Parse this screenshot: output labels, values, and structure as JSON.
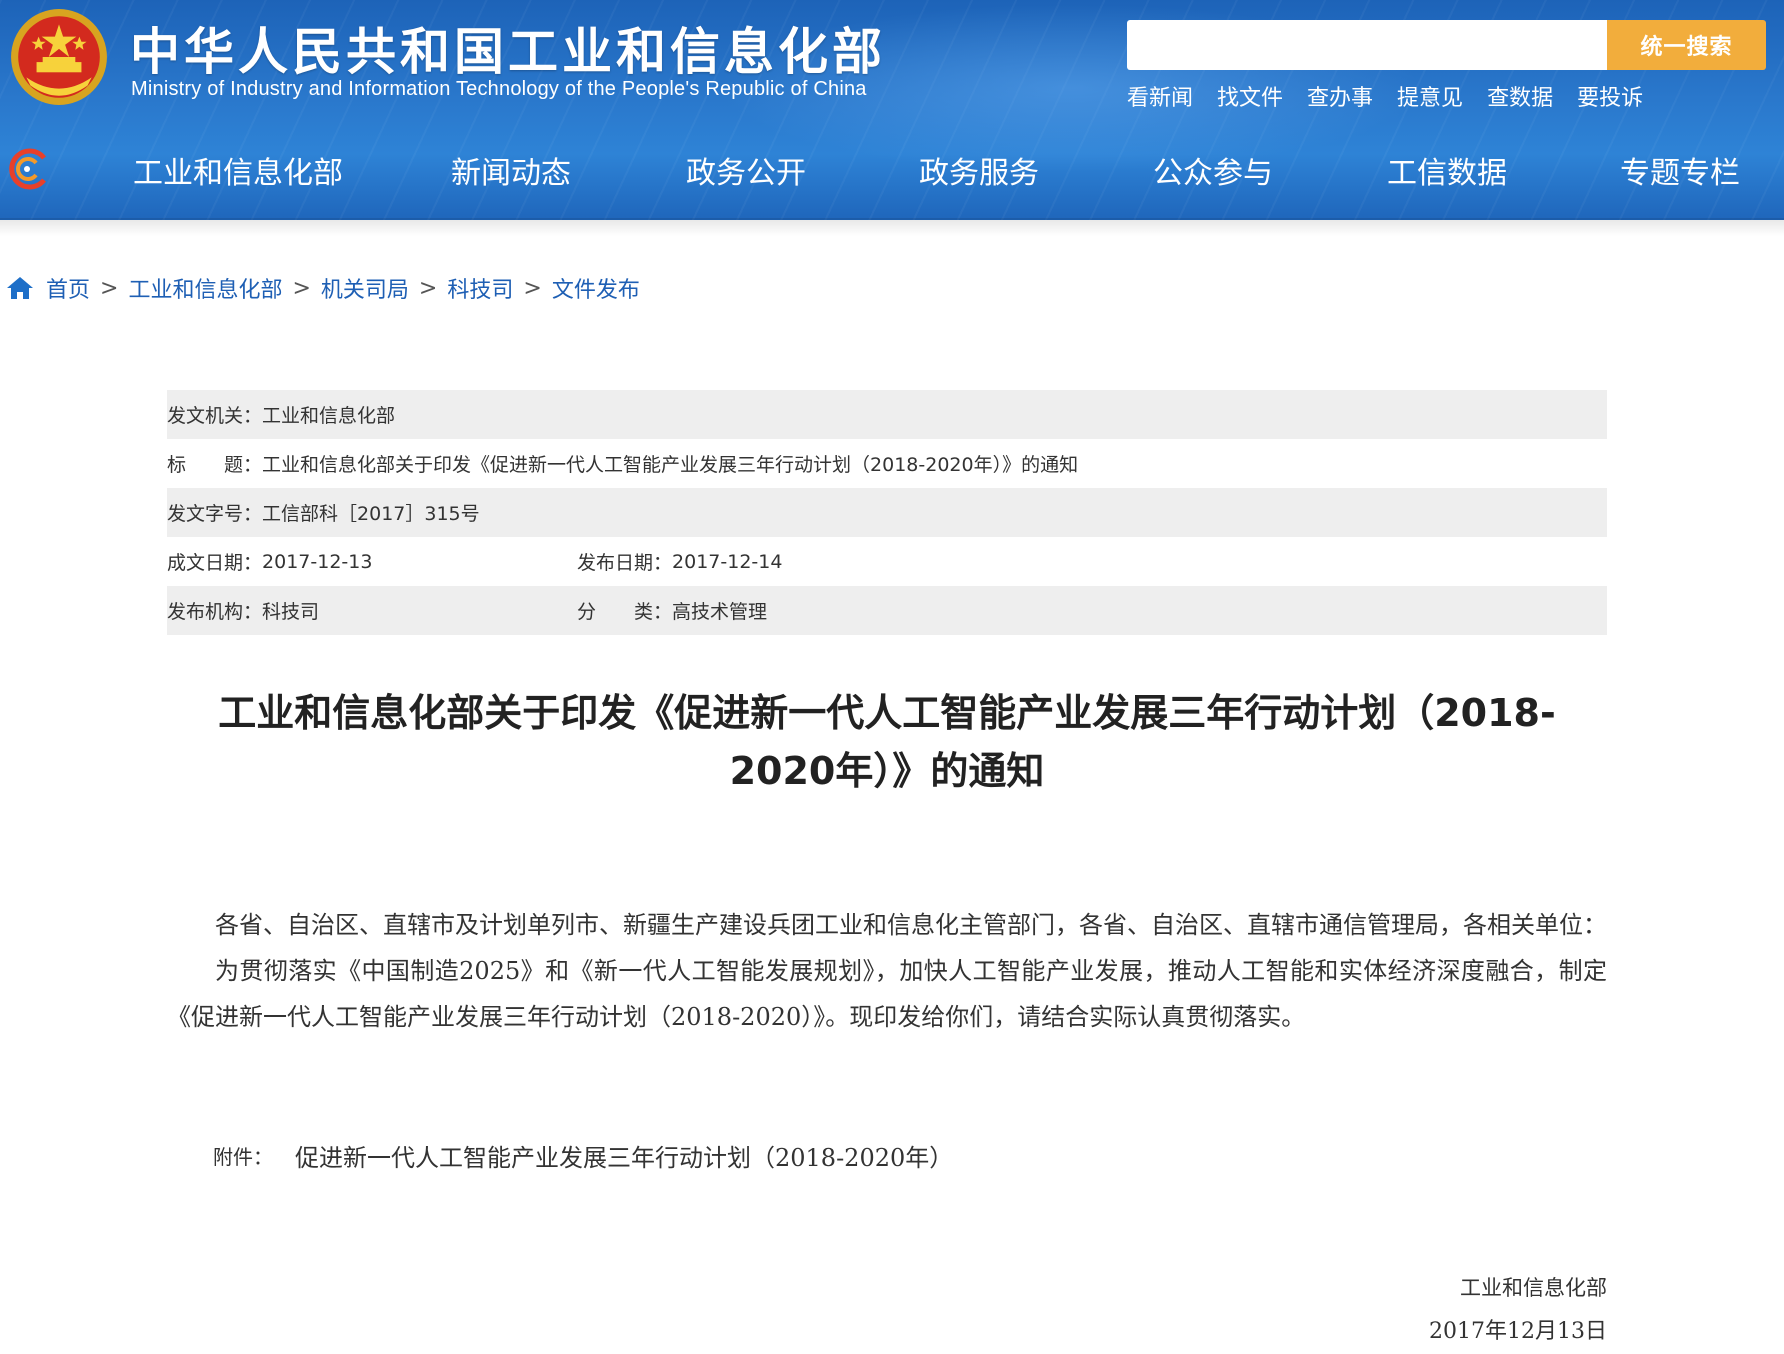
{
  "header": {
    "title": "中华人民共和国工业和信息化部",
    "subtitle": "Ministry of Industry and Information Technology of the People's Republic of China",
    "search": {
      "placeholder": "",
      "button_label": "统一搜索"
    },
    "quick_links": [
      "看新闻",
      "找文件",
      "查办事",
      "提意见",
      "查数据",
      "要投诉"
    ],
    "nav": [
      "工业和信息化部",
      "新闻动态",
      "政务公开",
      "政务服务",
      "公众参与",
      "工信数据",
      "专题专栏"
    ],
    "colors": {
      "header_blue": "#2a78cc",
      "search_button": "#f2ad3c"
    },
    "icons": {
      "emblem": "national-emblem-icon",
      "nav_logo": "miit-logo-icon"
    }
  },
  "breadcrumb": {
    "icon": "home-icon",
    "items": [
      "首页",
      "工业和信息化部",
      "机关司局",
      "科技司",
      "文件发布"
    ],
    "separator": ">"
  },
  "meta": {
    "issuer_label": "发文机关：",
    "issuer_value": "工业和信息化部",
    "title_label": "标　　题：",
    "title_value": "工业和信息化部关于印发《促进新一代人工智能产业发展三年行动计划（2018-2020年）》的通知",
    "doc_no_label": "发文字号：",
    "doc_no_value": "工信部科［2017］315号",
    "written_date_label": "成文日期：",
    "written_date_value": "2017-12-13",
    "publish_date_label": "发布日期：",
    "publish_date_value": "2017-12-14",
    "org_label": "发布机构：",
    "org_value": "科技司",
    "category_label": "分　　类：",
    "category_value": "高技术管理"
  },
  "article": {
    "title": "工业和信息化部关于印发《促进新一代人工智能产业发展三年行动计划（2018-2020年）》的通知",
    "paragraphs": [
      "各省、自治区、直辖市及计划单列市、新疆生产建设兵团工业和信息化主管部门，各省、自治区、直辖市通信管理局，各相关单位：",
      "为贯彻落实《中国制造2025》和《新一代人工智能发展规划》，加快人工智能产业发展，推动人工智能和实体经济深度融合，制定《促进新一代人工智能产业发展三年行动计划（2018-2020）》。现印发给你们，请结合实际认真贯彻落实。"
    ],
    "attachment_label": "附件：",
    "attachment_link": "促进新一代人工智能产业发展三年行动计划（2018-2020年）",
    "signoff_org": "工业和信息化部",
    "signoff_date": "2017年12月13日"
  }
}
